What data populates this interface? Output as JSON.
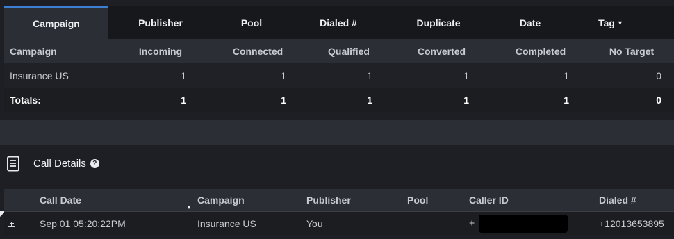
{
  "tabs": [
    {
      "label": "Campaign",
      "active": true
    },
    {
      "label": "Publisher"
    },
    {
      "label": "Pool"
    },
    {
      "label": "Dialed #"
    },
    {
      "label": "Duplicate"
    },
    {
      "label": "Date"
    },
    {
      "label": "Tag",
      "icon": "caret-down-icon"
    }
  ],
  "summary": {
    "columns": [
      "Campaign",
      "Incoming",
      "Connected",
      "Qualified",
      "Converted",
      "Completed",
      "No Target"
    ],
    "rows": [
      [
        "Insurance US",
        "1",
        "1",
        "1",
        "1",
        "1",
        "0"
      ]
    ],
    "totals": [
      "Totals:",
      "1",
      "1",
      "1",
      "1",
      "1",
      "0"
    ]
  },
  "call_details": {
    "title": "Call Details",
    "icon": "document-icon",
    "help_icon": "question-circle-icon",
    "help_glyph": "?",
    "columns": [
      "Call Date",
      "Campaign",
      "Publisher",
      "Pool",
      "Caller ID",
      "Dialed #"
    ],
    "rows": [
      {
        "call_date": "Sep 01 05:20:22PM",
        "campaign": "Insurance US",
        "publisher": "You",
        "pool": "",
        "caller_id_prefix": "+",
        "dialed": "+12013653895"
      }
    ]
  },
  "colors": {
    "active_tab_accent": "#3d7fd4",
    "background": "#1d1f24",
    "header_row": "#2b2e35"
  }
}
